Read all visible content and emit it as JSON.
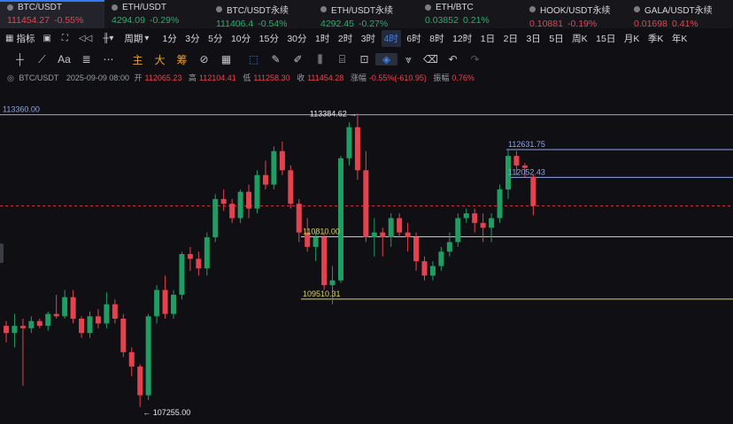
{
  "tickers": [
    {
      "name": "BTC/USDT",
      "price": "111454.27",
      "change": "-0.55%",
      "dir": "down",
      "active": true
    },
    {
      "name": "ETH/USDT",
      "price": "4294.09",
      "change": "-0.29%",
      "dir": "up",
      "active": false
    },
    {
      "name": "BTC/USDT永续",
      "price": "111406.4",
      "change": "-0.54%",
      "dir": "up",
      "active": false
    },
    {
      "name": "ETH/USDT永续",
      "price": "4292.45",
      "change": "-0.27%",
      "dir": "up",
      "active": false
    },
    {
      "name": "ETH/BTC",
      "price": "0.03852",
      "change": "0.21%",
      "dir": "up",
      "active": false
    },
    {
      "name": "HOOK/USDT永续",
      "price": "0.10881",
      "change": "-0.19%",
      "dir": "down",
      "active": false
    },
    {
      "name": "GALA/USDT永续",
      "price": "0.01698",
      "change": "0.41%",
      "dir": "down",
      "active": false
    }
  ],
  "toolbar": {
    "indicator_label": "指标",
    "period_label": "周期",
    "timeframes": [
      "1分",
      "3分",
      "5分",
      "10分",
      "15分",
      "30分",
      "1时",
      "2时",
      "3时",
      "4时",
      "6时",
      "8时",
      "12时",
      "1日",
      "2日",
      "3日",
      "5日",
      "周K",
      "15日",
      "月K",
      "季K",
      "年K"
    ],
    "active_timeframe": "4时"
  },
  "draw_tools": {
    "main_label": "主",
    "big_label": "大",
    "chip_label": "筹",
    "text_label": "Aa",
    "icons": [
      "crosshair-vertical-icon",
      "trend-line-icon",
      "text-icon",
      "fibonacci-icon",
      "more-dots-icon",
      "main-indicator-icon",
      "big-order-icon",
      "chip-distribution-icon",
      "cycle-icon",
      "calendar-icon",
      "select-box-icon",
      "pen-icon",
      "brush-icon",
      "candle-tool-icon",
      "clip-icon",
      "magnet-icon",
      "erase-icon",
      "filter-icon",
      "trash-icon",
      "undo-icon",
      "redo-icon"
    ]
  },
  "info": {
    "symbol": "BTC/USDT",
    "datetime": "2025-09-09 08:00",
    "open_label": "开",
    "open": "112065.23",
    "high_label": "高",
    "high": "112104.41",
    "low_label": "低",
    "low": "111258.30",
    "close_label": "收",
    "close": "111454.28",
    "change_label": "涨幅",
    "change": "-0.55%(-610.95)",
    "amp_label": "振幅",
    "amp": "0.76%"
  },
  "chart_data": {
    "type": "candlestick",
    "ylim": [
      106900,
      114000
    ],
    "up_color": "#1f9d63",
    "down_color": "#e5424f",
    "candles": [
      {
        "o": 108950,
        "h": 109050,
        "l": 108600,
        "c": 108800
      },
      {
        "o": 108800,
        "h": 109200,
        "l": 108500,
        "c": 108950
      },
      {
        "o": 108950,
        "h": 109100,
        "l": 107700,
        "c": 108900
      },
      {
        "o": 108900,
        "h": 109150,
        "l": 108800,
        "c": 109050
      },
      {
        "o": 109050,
        "h": 109100,
        "l": 108900,
        "c": 108950
      },
      {
        "o": 108950,
        "h": 109250,
        "l": 108850,
        "c": 109200
      },
      {
        "o": 109200,
        "h": 109600,
        "l": 109100,
        "c": 109150
      },
      {
        "o": 109150,
        "h": 109700,
        "l": 109100,
        "c": 109550
      },
      {
        "o": 109550,
        "h": 109700,
        "l": 109000,
        "c": 109100
      },
      {
        "o": 109100,
        "h": 109150,
        "l": 108700,
        "c": 108800
      },
      {
        "o": 108800,
        "h": 109250,
        "l": 108700,
        "c": 109150
      },
      {
        "o": 109150,
        "h": 109300,
        "l": 108900,
        "c": 109000
      },
      {
        "o": 109000,
        "h": 109650,
        "l": 108900,
        "c": 109400
      },
      {
        "o": 109400,
        "h": 109500,
        "l": 109000,
        "c": 109100
      },
      {
        "o": 109100,
        "h": 109200,
        "l": 108300,
        "c": 108400
      },
      {
        "o": 108400,
        "h": 108500,
        "l": 107900,
        "c": 108100
      },
      {
        "o": 108100,
        "h": 108150,
        "l": 107255,
        "c": 107500
      },
      {
        "o": 107500,
        "h": 109200,
        "l": 107400,
        "c": 109150
      },
      {
        "o": 109150,
        "h": 109800,
        "l": 109000,
        "c": 109700
      },
      {
        "o": 109700,
        "h": 110000,
        "l": 109100,
        "c": 109200
      },
      {
        "o": 109200,
        "h": 109700,
        "l": 109100,
        "c": 109600
      },
      {
        "o": 109600,
        "h": 110500,
        "l": 109500,
        "c": 110450
      },
      {
        "o": 110450,
        "h": 110600,
        "l": 110100,
        "c": 110350
      },
      {
        "o": 110350,
        "h": 110500,
        "l": 110000,
        "c": 110150
      },
      {
        "o": 110150,
        "h": 110900,
        "l": 110000,
        "c": 110800
      },
      {
        "o": 110800,
        "h": 111700,
        "l": 110700,
        "c": 111600
      },
      {
        "o": 111600,
        "h": 111800,
        "l": 111350,
        "c": 111500
      },
      {
        "o": 111500,
        "h": 111600,
        "l": 111100,
        "c": 111200
      },
      {
        "o": 111200,
        "h": 111800,
        "l": 111100,
        "c": 111750
      },
      {
        "o": 111750,
        "h": 111900,
        "l": 111200,
        "c": 111400
      },
      {
        "o": 111400,
        "h": 112200,
        "l": 111300,
        "c": 112100
      },
      {
        "o": 112100,
        "h": 112400,
        "l": 111800,
        "c": 111900
      },
      {
        "o": 111900,
        "h": 112700,
        "l": 111800,
        "c": 112600
      },
      {
        "o": 112600,
        "h": 112800,
        "l": 112100,
        "c": 112200
      },
      {
        "o": 112200,
        "h": 112300,
        "l": 111400,
        "c": 111500
      },
      {
        "o": 111500,
        "h": 111600,
        "l": 110700,
        "c": 110900
      },
      {
        "o": 110900,
        "h": 111200,
        "l": 110500,
        "c": 110600
      },
      {
        "o": 110600,
        "h": 110900,
        "l": 110300,
        "c": 110800
      },
      {
        "o": 110800,
        "h": 110900,
        "l": 109700,
        "c": 109800
      },
      {
        "o": 109800,
        "h": 110200,
        "l": 109400,
        "c": 109900
      },
      {
        "o": 109900,
        "h": 112500,
        "l": 109850,
        "c": 112450
      },
      {
        "o": 112450,
        "h": 113200,
        "l": 112300,
        "c": 113100
      },
      {
        "o": 113100,
        "h": 113384.62,
        "l": 112000,
        "c": 112200
      },
      {
        "o": 112200,
        "h": 112600,
        "l": 110700,
        "c": 110800
      },
      {
        "o": 110800,
        "h": 111200,
        "l": 110400,
        "c": 110900
      },
      {
        "o": 110900,
        "h": 111000,
        "l": 110400,
        "c": 110800
      },
      {
        "o": 110800,
        "h": 111300,
        "l": 110600,
        "c": 111200
      },
      {
        "o": 111200,
        "h": 111300,
        "l": 110800,
        "c": 110900
      },
      {
        "o": 110900,
        "h": 111100,
        "l": 110500,
        "c": 110800
      },
      {
        "o": 110800,
        "h": 110900,
        "l": 110100,
        "c": 110300
      },
      {
        "o": 110300,
        "h": 110400,
        "l": 109900,
        "c": 110000
      },
      {
        "o": 110000,
        "h": 110300,
        "l": 109900,
        "c": 110200
      },
      {
        "o": 110200,
        "h": 110600,
        "l": 110100,
        "c": 110500
      },
      {
        "o": 110500,
        "h": 110900,
        "l": 110400,
        "c": 110700
      },
      {
        "o": 110700,
        "h": 111300,
        "l": 110600,
        "c": 111200
      },
      {
        "o": 111200,
        "h": 111400,
        "l": 111100,
        "c": 111300
      },
      {
        "o": 111300,
        "h": 111400,
        "l": 110900,
        "c": 111100
      },
      {
        "o": 111100,
        "h": 111300,
        "l": 110700,
        "c": 111000
      },
      {
        "o": 111000,
        "h": 111300,
        "l": 110700,
        "c": 111200
      },
      {
        "o": 111200,
        "h": 111900,
        "l": 111100,
        "c": 111800
      },
      {
        "o": 111800,
        "h": 112631.75,
        "l": 111600,
        "c": 112500
      },
      {
        "o": 112500,
        "h": 112600,
        "l": 112100,
        "c": 112300
      },
      {
        "o": 112300,
        "h": 112350,
        "l": 112050,
        "c": 112250
      },
      {
        "o": 112065.23,
        "h": 112104.41,
        "l": 111258.3,
        "c": 111454.28
      }
    ],
    "hlines": [
      {
        "value": 113360.0,
        "label": "113360.00",
        "color": "#8ea6e8"
      },
      {
        "value": 112631.75,
        "label": "112631.75",
        "color": "#8ea6e8"
      },
      {
        "value": 112052.43,
        "label": "112052.43",
        "color": "#8ea6e8"
      },
      {
        "value": 110810.0,
        "label": "110810.00",
        "color": "#d9d25a"
      },
      {
        "value": 109510.31,
        "label": "109510.31",
        "color": "#d9d25a"
      }
    ],
    "current_price": 111454.28,
    "annotations": [
      {
        "text": "113384.62",
        "value": 113384.62
      },
      {
        "text": "107255.00",
        "value": 107255.0
      }
    ]
  }
}
